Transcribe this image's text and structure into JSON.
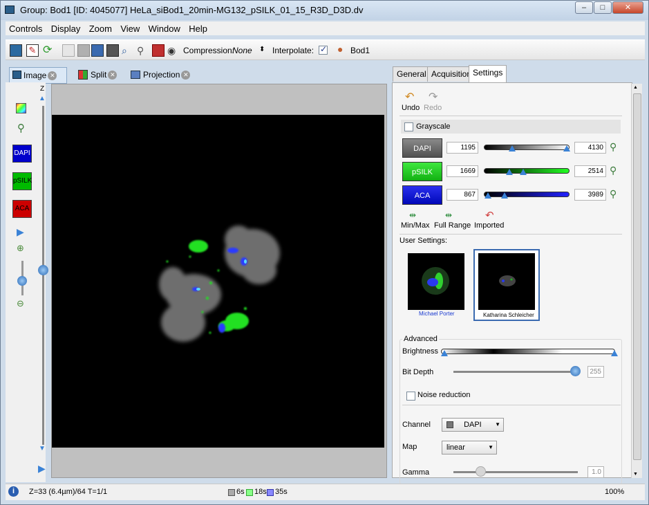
{
  "window": {
    "title": "Group: Bod1 [ID: 4045077] HeLa_siBod1_20min-MG132_pSILK_01_15_R3D_D3D.dv",
    "controls": [
      "–",
      "□",
      "✕"
    ]
  },
  "menu": {
    "items": [
      "Controls",
      "Display",
      "Zoom",
      "View",
      "Window",
      "Help"
    ]
  },
  "toolbar": {
    "compression_label": "Compression:",
    "compression_value": "None",
    "interpolate_label": "Interpolate:",
    "group_label": "Bod1"
  },
  "view_tabs": [
    {
      "label": "Image"
    },
    {
      "label": "Split"
    },
    {
      "label": "Projection"
    }
  ],
  "sidebar": {
    "z_label": "Z",
    "channels": [
      {
        "label": "DAPI",
        "color": "#0000cc"
      },
      {
        "label": "pSILK",
        "color": "#00bb00"
      },
      {
        "label": "ACA",
        "color": "#cc0000"
      }
    ]
  },
  "right_tabs": [
    {
      "label": "General"
    },
    {
      "label": "Acquisition"
    },
    {
      "label": "Settings"
    }
  ],
  "settings": {
    "undo_label": "Undo",
    "redo_label": "Redo",
    "grayscale_label": "Grayscale",
    "channels": [
      {
        "name": "DAPI",
        "min": "1195",
        "max": "4130",
        "color": "#6b6b6b"
      },
      {
        "name": "pSILK",
        "min": "1669",
        "max": "2514",
        "color": "#1ccc1c"
      },
      {
        "name": "ACA",
        "min": "867",
        "max": "3989",
        "color": "#0a10d0"
      }
    ],
    "range_buttons": [
      "Min/Max",
      "Full Range",
      "Imported"
    ],
    "user_settings_label": "User Settings:",
    "users": [
      "Michael Porter",
      "Katharina Schleicher"
    ],
    "advanced_label": "Advanced",
    "brightness_label": "Brightness",
    "bitdepth_label": "Bit Depth",
    "bitdepth_value": "255",
    "noise_label": "Noise reduction",
    "channel_label": "Channel",
    "channel_value": "DAPI",
    "map_label": "Map",
    "map_value": "linear",
    "gamma_label": "Gamma",
    "gamma_value": "1.0"
  },
  "status": {
    "position": "Z=33 (6.4µm)/64 T=1/1",
    "times": [
      "6s",
      "18s",
      "35s"
    ],
    "zoom": "100%"
  }
}
